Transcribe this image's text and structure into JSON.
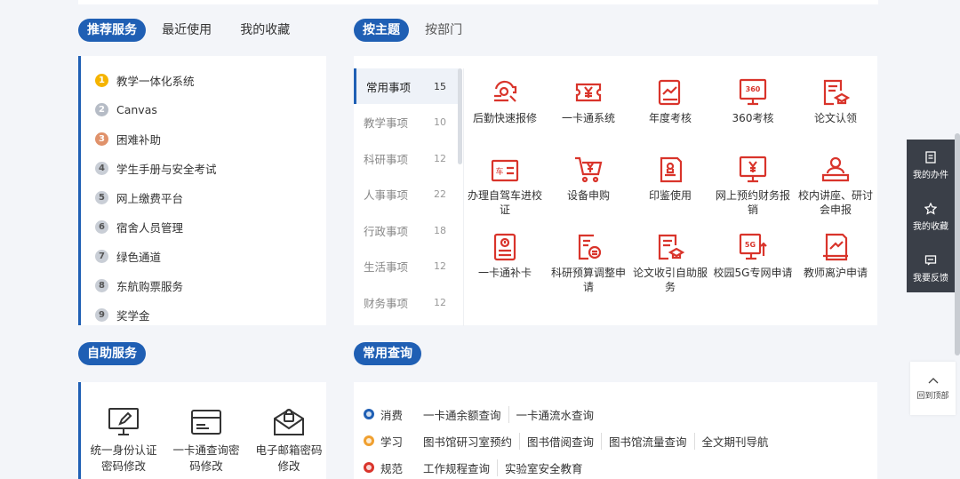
{
  "tabs_left": {
    "active": "推荐服务",
    "recent": "最近使用",
    "favorites": "我的收藏"
  },
  "tabs_right": {
    "active": "按主题",
    "by_dept": "按部门"
  },
  "recommended": [
    {
      "num": "1",
      "label": "教学一体化系统",
      "color": "#f5b400"
    },
    {
      "num": "2",
      "label": "Canvas",
      "color": "#b6bcc6"
    },
    {
      "num": "3",
      "label": "困难补助",
      "color": "#e0926b"
    },
    {
      "num": "4",
      "label": "学生手册与安全考试",
      "color": "#c9ced6"
    },
    {
      "num": "5",
      "label": "网上缴费平台",
      "color": "#c9ced6"
    },
    {
      "num": "6",
      "label": "宿舍人员管理",
      "color": "#c9ced6"
    },
    {
      "num": "7",
      "label": "绿色通道",
      "color": "#c9ced6"
    },
    {
      "num": "8",
      "label": "东航购票服务",
      "color": "#c9ced6"
    },
    {
      "num": "9",
      "label": "奖学金",
      "color": "#c9ced6"
    }
  ],
  "categories": [
    {
      "label": "常用事项",
      "count": "15"
    },
    {
      "label": "教学事项",
      "count": "10"
    },
    {
      "label": "科研事项",
      "count": "12"
    },
    {
      "label": "人事事项",
      "count": "22"
    },
    {
      "label": "行政事项",
      "count": "18"
    },
    {
      "label": "生活事项",
      "count": "12"
    },
    {
      "label": "财务事项",
      "count": "12"
    }
  ],
  "services": [
    {
      "label": "后勤快速报修",
      "icon": "repair-icon"
    },
    {
      "label": "一卡通系统",
      "icon": "card-yen-icon"
    },
    {
      "label": "年度考核",
      "icon": "assessment-icon"
    },
    {
      "label": "360考核",
      "icon": "360-monitor-icon"
    },
    {
      "label": "论文认领",
      "icon": "paper-claim-icon"
    },
    {
      "label": "办理自驾车进校证",
      "icon": "car-pass-icon"
    },
    {
      "label": "设备申购",
      "icon": "cart-icon"
    },
    {
      "label": "印鉴使用",
      "icon": "seal-icon"
    },
    {
      "label": "网上预约财务报销",
      "icon": "finance-monitor-icon"
    },
    {
      "label": "校内讲座、研讨会申报",
      "icon": "lecture-icon"
    },
    {
      "label": "一卡通补卡",
      "icon": "card-reissue-icon"
    },
    {
      "label": "科研预算调整申请",
      "icon": "budget-icon"
    },
    {
      "label": "论文收引自助服务",
      "icon": "citation-icon"
    },
    {
      "label": "校园5G专网申请",
      "icon": "5g-icon"
    },
    {
      "label": "教师离沪申请",
      "icon": "leave-icon"
    }
  ],
  "self_service": {
    "title": "自助服务",
    "items": [
      {
        "label": "统一身份认证密码修改",
        "icon": "monitor-edit-icon"
      },
      {
        "label": "一卡通查询密码修改",
        "icon": "card-icon"
      },
      {
        "label": "电子邮箱密码修改",
        "icon": "mail-lock-icon"
      }
    ]
  },
  "common_query": {
    "title": "常用查询",
    "rows": [
      {
        "cat": "消费",
        "color": "#1f5fb4",
        "links": [
          "一卡通余额查询",
          "一卡通流水查询"
        ]
      },
      {
        "cat": "学习",
        "color": "#f0a030",
        "links": [
          "图书馆研习室预约",
          "图书借阅查询",
          "图书馆流量查询",
          "全文期刊导航"
        ]
      },
      {
        "cat": "规范",
        "color": "#d9342b",
        "links": [
          "工作规程查询",
          "实验室安全教育"
        ]
      }
    ]
  },
  "float_bar": {
    "my_tasks": "我的办件",
    "my_favorites": "我的收藏",
    "feedback": "我要反馈"
  },
  "back_to_top": "回到顶部",
  "colors": {
    "accent": "#1f5fb4",
    "icon_red": "#d9342b"
  }
}
